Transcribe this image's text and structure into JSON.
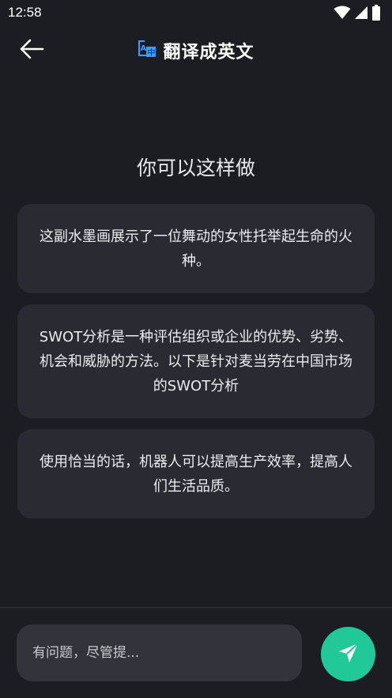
{
  "status_bar": {
    "time": "12:58",
    "icons": [
      "wifi-icon",
      "cellular-signal-icon",
      "battery-icon"
    ]
  },
  "header": {
    "back_icon": "arrow-left-icon",
    "title_icon": "translate-icon",
    "title": "翻译成英文"
  },
  "suggestions": {
    "heading": "你可以这样做",
    "items": [
      {
        "text": "这副水墨画展示了一位舞动的女性托举起生命的火种。"
      },
      {
        "text": "SWOT分析是一种评估组织或企业的优势、劣势、机会和威胁的方法。以下是针对麦当劳在中国市场的SWOT分析"
      },
      {
        "text": "使用恰当的话，机器人可以提高生产效率，提高人们生活品质。"
      }
    ]
  },
  "composer": {
    "placeholder": "有问题，尽管提...",
    "value": "",
    "send_icon": "send-icon"
  },
  "colors": {
    "background": "#1c1d22",
    "card": "#2a2b32",
    "input": "#33343b",
    "accent": "#20c997",
    "title_icon": "#3b9cff"
  }
}
